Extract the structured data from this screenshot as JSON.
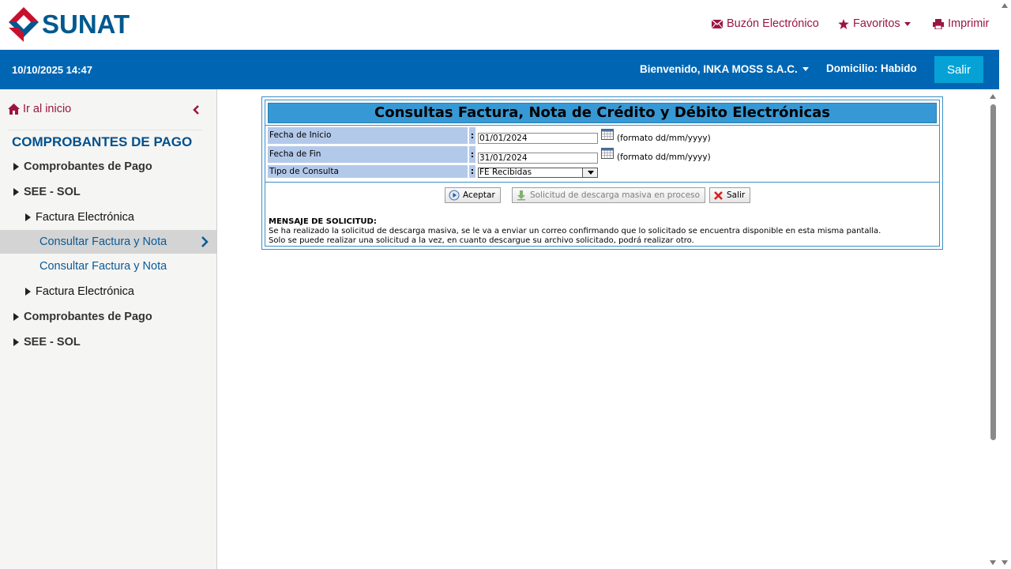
{
  "header": {
    "logo_text": "SUNAT",
    "links": {
      "buzon": "Buzón Electrónico",
      "favoritos": "Favoritos",
      "imprimir": "Imprimir"
    }
  },
  "bluebar": {
    "datetime": "10/10/2025 14:47",
    "welcome": "Bienvenido, INKA MOSS S.A.C.",
    "domicilio": "Domicilio: Habido",
    "salir": "Salir"
  },
  "sidebar": {
    "home": "Ir al inicio",
    "title": "COMPROBANTES DE PAGO",
    "items": [
      {
        "label": "Comprobantes de Pago"
      },
      {
        "label": "SEE - SOL"
      },
      {
        "label": "Factura Electrónica"
      },
      {
        "label": "Consultar Factura y Nota"
      },
      {
        "label": "Consultar Factura y Nota"
      },
      {
        "label": "Factura Electrónica"
      },
      {
        "label": "Comprobantes de Pago"
      },
      {
        "label": "SEE - SOL"
      }
    ]
  },
  "form": {
    "title": "Consultas Factura, Nota de Crédito y Débito Electrónicas",
    "fecha_inicio_label": "Fecha de Inicio",
    "fecha_inicio_value": "01/01/2024",
    "fecha_fin_label": "Fecha de Fin",
    "fecha_fin_value": "31/01/2024",
    "format_hint": "(formato dd/mm/yyyy)",
    "tipo_label": "Tipo de Consulta",
    "tipo_value": "FE Recibidas",
    "colon": ":",
    "buttons": {
      "aceptar": "Aceptar",
      "descarga": "Solicitud de descarga masiva en proceso",
      "salir": "Salir"
    },
    "message": {
      "title": "MENSAJE DE SOLICITUD:",
      "line1": "Se ha realizado la solicitud de descarga masiva, se le va a enviar un correo confirmando que lo solicitado se encuentra disponible en esta misma pantalla.",
      "line2": "Solo se puede realizar una solicitud a la vez, en cuanto descargue su archivo solicitado, podrá realizar otro."
    }
  },
  "colors": {
    "brand_blue": "#0066b3",
    "brand_red": "#9b1543",
    "panel_title": "#3699d5",
    "label_bg": "#b3c9ea",
    "salir_btn": "#06a2d6"
  },
  "icons": {
    "logo": "sunat-logo-icon",
    "buzon": "envelope-icon",
    "favoritos": "star-icon",
    "imprimir": "printer-icon",
    "home": "home-icon",
    "collapse": "chevron-left-icon",
    "calendar": "calendar-icon"
  }
}
